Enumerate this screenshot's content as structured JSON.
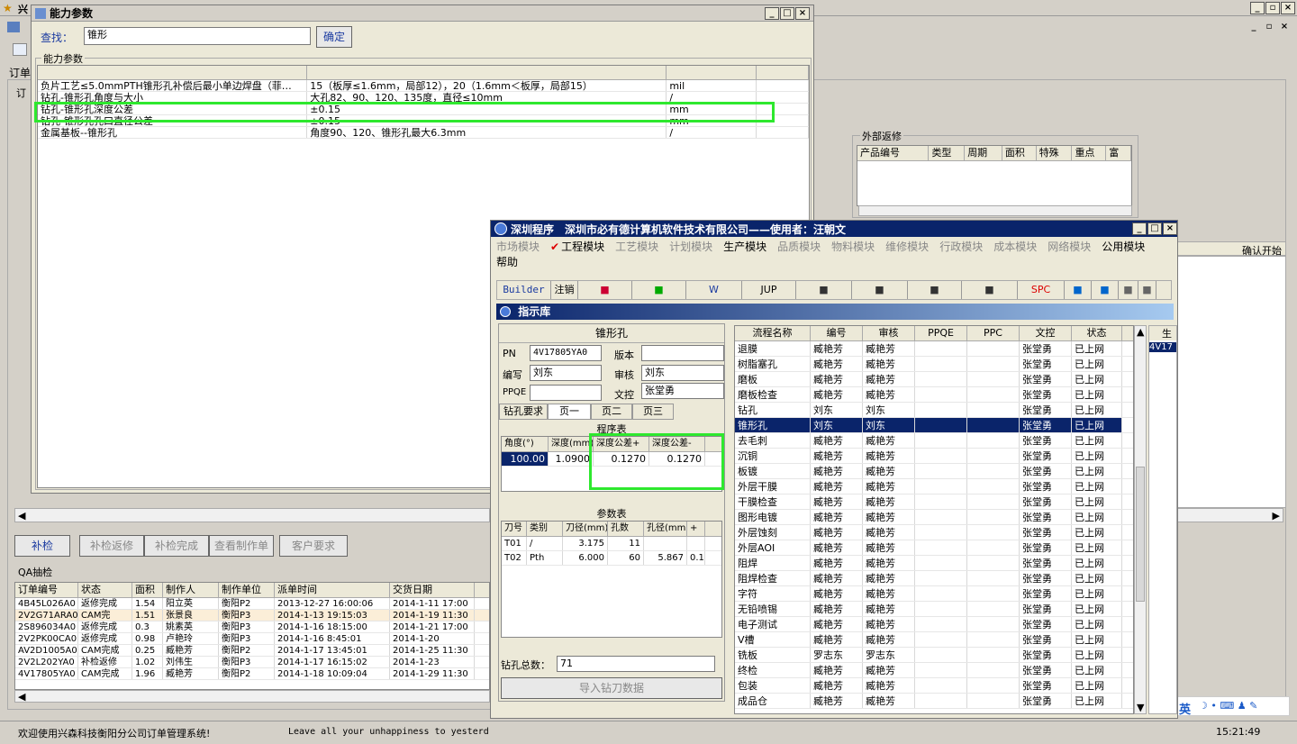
{
  "bg": {
    "title_frag": "兴",
    "menu_frag": "订单",
    "sub_frag": "订"
  },
  "nl": {
    "title": "能力参数",
    "find_label": "查找：",
    "find_value": "锥形",
    "ok": "确定",
    "group": "能力参数",
    "rows": [
      [
        "负片工艺≤5.0mmPTH锥形孔补偿后最小单边焊盘（菲…",
        "15（板厚≤1.6mm，局部12），20（1.6mm＜板厚，局部15）",
        "mil"
      ],
      [
        "钻孔-锥形孔角度与大小",
        "大孔82、90、120、135度，直径≤10mm",
        "/"
      ],
      [
        "钻孔-锥形孔深度公差",
        "±0.15",
        "mm"
      ],
      [
        "钻孔-锥形孔孔口直径公差",
        "±0.15",
        "mm"
      ],
      [
        "金属基板--锥形孔",
        "角度90、120、锥形孔最大6.3mm",
        "/"
      ]
    ]
  },
  "ext": {
    "group": "外部返修",
    "cols": [
      "产品编号",
      "类型",
      "周期",
      "面积",
      "特殊",
      "重点",
      "富"
    ]
  },
  "right_hdr": {
    "col": "确认开始"
  },
  "buttons": [
    "补检",
    "补检返修",
    "补检完成",
    "查看制作单",
    "客户要求"
  ],
  "qa": {
    "title": "QA抽检",
    "cols": [
      "订单编号",
      "状态",
      "面积",
      "制作人",
      "制作单位",
      "派单时间",
      "交货日期"
    ],
    "rows": [
      [
        "4B45L026A0",
        "返修完成",
        "1.54",
        "阳立英",
        "衡阳P2",
        "2013-12-27 16:00:06",
        "2014-1-11 17:00"
      ],
      [
        "2V2G71ARA0",
        "CAM完",
        "1.51",
        "张景良",
        "衡阳P3",
        "2014-1-13 19:15:03",
        "2014-1-19 11:30"
      ],
      [
        "2S896034A0",
        "返修完成",
        "0.3",
        "姚素英",
        "衡阳P3",
        "2014-1-16 18:15:00",
        "2014-1-21 17:00"
      ],
      [
        "2V2PK00CA0",
        "返修完成",
        "0.98",
        "卢艳玲",
        "衡阳P3",
        "2014-1-16 8:45:01",
        "2014-1-20"
      ],
      [
        "AV2D1005A0",
        "CAM完成",
        "0.25",
        "臧艳芳",
        "衡阳P2",
        "2014-1-17 13:45:01",
        "2014-1-25 11:30"
      ],
      [
        "2V2L202YA0",
        "补检返修",
        "1.02",
        "刘伟生",
        "衡阳P3",
        "2014-1-17 16:15:02",
        "2014-1-23"
      ],
      [
        "4V17805YA0",
        "CAM完成",
        "1.96",
        "臧艳芳",
        "衡阳P2",
        "2014-1-18 10:09:04",
        "2014-1-29 11:30"
      ]
    ]
  },
  "status": {
    "welcome": "欢迎使用兴森科技衡阳分公司订单管理系统!",
    "marquee": "Leave all your unhappiness to yesterd",
    "time": "15:21:49"
  },
  "sz": {
    "title": "深圳程序　深圳市必有德计算机软件技术有限公司——使用者：汪朝文",
    "menu": [
      "市场模块",
      "工程模块",
      "工艺模块",
      "计划模块",
      "生产模块",
      "品质模块",
      "物料模块",
      "维修模块",
      "行政模块",
      "成本模块",
      "网络模块",
      "公用模块",
      "帮助"
    ],
    "toolbar": [
      "Builder",
      "注销",
      "",
      "",
      "W",
      "JUP",
      "",
      "",
      "",
      "",
      "SPC",
      "",
      "",
      "",
      ""
    ],
    "lib_title": "指示库",
    "part_title": "锥形孔",
    "pn_label": "PN",
    "pn": "4V17805YA0",
    "ver_label": "版本",
    "ver": "",
    "write_label": "编写",
    "write": "刘东",
    "check_label": "审核",
    "check": "刘东",
    "ppqe_label": "PPQE",
    "ppqe": "",
    "doc_label": "文控",
    "doc": "张堂勇",
    "tabs": [
      "钻孔要求",
      "页一",
      "页二",
      "页三"
    ],
    "prog_title": "程序表",
    "prog_cols": [
      "角度(°)",
      "深度(mm)",
      "深度公差+",
      "深度公差-"
    ],
    "prog_row": [
      "100.00",
      "1.0900",
      "0.1270",
      "0.1270"
    ],
    "param_title": "参数表",
    "param_cols": [
      "刀号",
      "类别",
      "刀径(mm)",
      "孔数",
      "孔径(mm)",
      "+"
    ],
    "param_rows": [
      [
        "T01",
        "/",
        "3.175",
        "11",
        "",
        ""
      ],
      [
        "T02",
        "Pth",
        "6.000",
        "60",
        "5.867",
        "0.1"
      ]
    ],
    "total_label": "钻孔总数：",
    "total": "71",
    "import": "导入钻刀数据",
    "flow_cols": [
      "流程名称",
      "编号",
      "审核",
      "PPQE",
      "PPC",
      "文控",
      "状态"
    ],
    "flow": [
      [
        "退膜",
        "臧艳芳",
        "臧艳芳",
        "",
        "",
        "张堂勇",
        "已上网"
      ],
      [
        "树脂塞孔",
        "臧艳芳",
        "臧艳芳",
        "",
        "",
        "张堂勇",
        "已上网"
      ],
      [
        "磨板",
        "臧艳芳",
        "臧艳芳",
        "",
        "",
        "张堂勇",
        "已上网"
      ],
      [
        "磨板检查",
        "臧艳芳",
        "臧艳芳",
        "",
        "",
        "张堂勇",
        "已上网"
      ],
      [
        "钻孔",
        "刘东",
        "刘东",
        "",
        "",
        "张堂勇",
        "已上网"
      ],
      [
        "锥形孔",
        "刘东",
        "刘东",
        "",
        "",
        "张堂勇",
        "已上网"
      ],
      [
        "去毛刺",
        "臧艳芳",
        "臧艳芳",
        "",
        "",
        "张堂勇",
        "已上网"
      ],
      [
        "沉铜",
        "臧艳芳",
        "臧艳芳",
        "",
        "",
        "张堂勇",
        "已上网"
      ],
      [
        "板镀",
        "臧艳芳",
        "臧艳芳",
        "",
        "",
        "张堂勇",
        "已上网"
      ],
      [
        "外层干膜",
        "臧艳芳",
        "臧艳芳",
        "",
        "",
        "张堂勇",
        "已上网"
      ],
      [
        "干膜检查",
        "臧艳芳",
        "臧艳芳",
        "",
        "",
        "张堂勇",
        "已上网"
      ],
      [
        "图形电镀",
        "臧艳芳",
        "臧艳芳",
        "",
        "",
        "张堂勇",
        "已上网"
      ],
      [
        "外层蚀刻",
        "臧艳芳",
        "臧艳芳",
        "",
        "",
        "张堂勇",
        "已上网"
      ],
      [
        "外层AOI",
        "臧艳芳",
        "臧艳芳",
        "",
        "",
        "张堂勇",
        "已上网"
      ],
      [
        "阻焊",
        "臧艳芳",
        "臧艳芳",
        "",
        "",
        "张堂勇",
        "已上网"
      ],
      [
        "阻焊检查",
        "臧艳芳",
        "臧艳芳",
        "",
        "",
        "张堂勇",
        "已上网"
      ],
      [
        "字符",
        "臧艳芳",
        "臧艳芳",
        "",
        "",
        "张堂勇",
        "已上网"
      ],
      [
        "无铅喷锡",
        "臧艳芳",
        "臧艳芳",
        "",
        "",
        "张堂勇",
        "已上网"
      ],
      [
        "电子测试",
        "臧艳芳",
        "臧艳芳",
        "",
        "",
        "张堂勇",
        "已上网"
      ],
      [
        "V槽",
        "臧艳芳",
        "臧艳芳",
        "",
        "",
        "张堂勇",
        "已上网"
      ],
      [
        "铣板",
        "罗志东",
        "罗志东",
        "",
        "",
        "张堂勇",
        "已上网"
      ],
      [
        "终检",
        "臧艳芳",
        "臧艳芳",
        "",
        "",
        "张堂勇",
        "已上网"
      ],
      [
        "包装",
        "臧艳芳",
        "臧艳芳",
        "",
        "",
        "张堂勇",
        "已上网"
      ],
      [
        "成品仓",
        "臧艳芳",
        "臧艳芳",
        "",
        "",
        "张堂勇",
        "已上网"
      ]
    ],
    "side_hdr": "生",
    "side_val": "4V17"
  },
  "ime": {
    "label": "英"
  }
}
